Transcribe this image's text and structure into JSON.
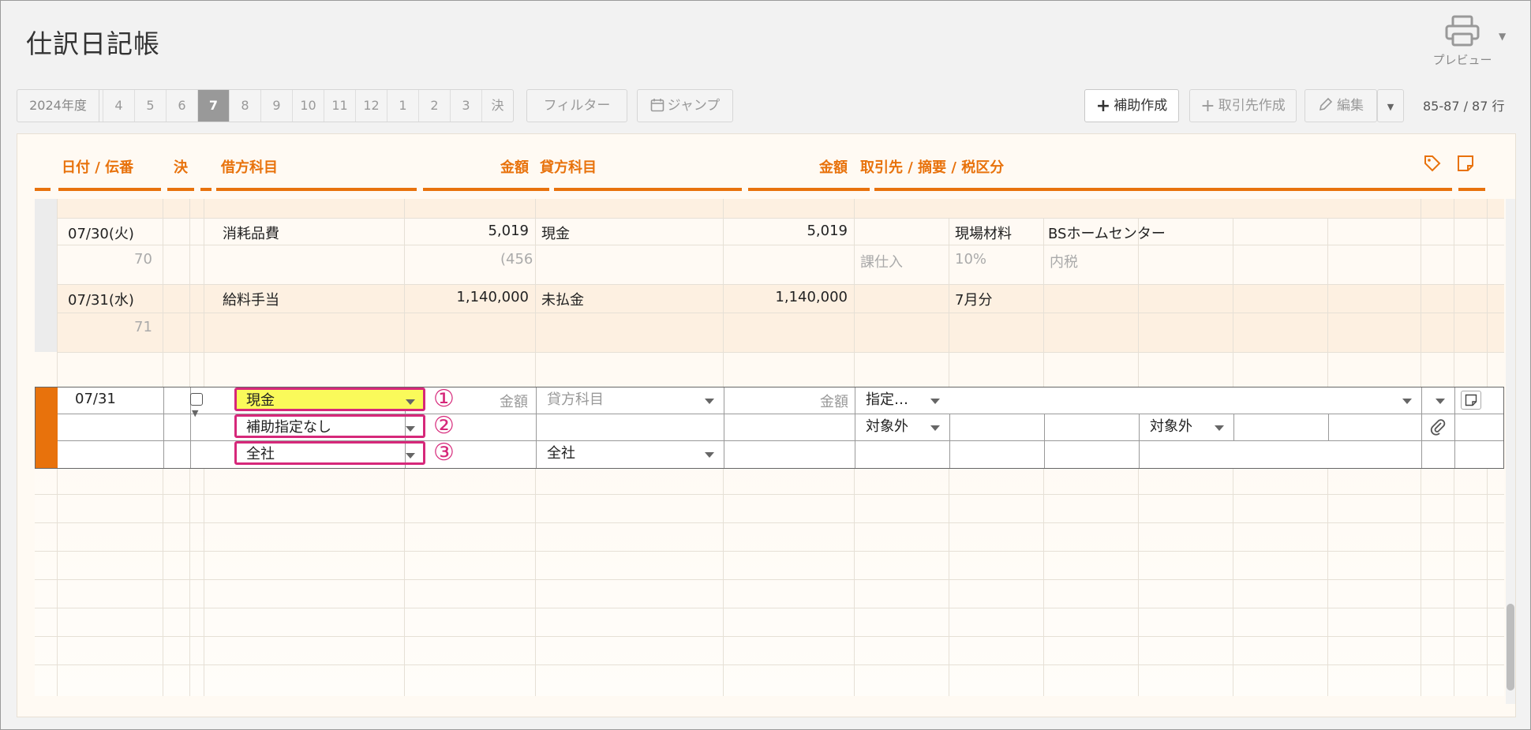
{
  "header": {
    "title": "仕訳日記帳",
    "print_label": "プレビュー"
  },
  "toolbar": {
    "year": "2024年度",
    "months": [
      "4",
      "5",
      "6",
      "7",
      "8",
      "9",
      "10",
      "11",
      "12",
      "1",
      "2",
      "3",
      "決"
    ],
    "active_month": "7",
    "filter_label": "フィルター",
    "jump_label": "ジャンプ",
    "add_sub_label": "補助作成",
    "add_partner_label": "取引先作成",
    "edit_label": "編集",
    "row_count": "85-87 / 87 行"
  },
  "columns": {
    "date": "日付 / 伝番",
    "settle": "決",
    "debit_account": "借方科目",
    "debit_amount": "金額",
    "credit_account": "貸方科目",
    "credit_amount": "金額",
    "partner": "取引先 / 摘要 / 税区分"
  },
  "rows": [
    {
      "date": "07/30(火)",
      "slip": "70",
      "debit_account": "消耗品費",
      "debit_amount": "5,019",
      "debit_tax": "(456",
      "credit_account": "現金",
      "credit_amount": "5,019",
      "memo1": "現場材料",
      "memo2": "BSホームセンター",
      "tax_class": "課仕入",
      "tax_rate": "10%",
      "tax_type": "内税"
    },
    {
      "date": "07/31(水)",
      "slip": "71",
      "debit_account": "給料手当",
      "debit_amount": "1,140,000",
      "credit_account": "未払金",
      "credit_amount": "1,140,000",
      "memo1": "7月分"
    }
  ],
  "entry": {
    "date": "07/31",
    "debit_account": "現金",
    "debit_sub": "補助指定なし",
    "debit_dept": "全社",
    "amount_placeholder": "金額",
    "credit_placeholder": "貸方科目",
    "credit_amount_placeholder": "金額",
    "credit_dept": "全社",
    "partner": "指定…",
    "tax1": "対象外",
    "tax2": "対象外"
  },
  "annotations": [
    "①",
    "②",
    "③"
  ],
  "colors": {
    "accent": "#e8720c",
    "highlight": "#d6287a",
    "selected_fill": "#fafa5a"
  }
}
